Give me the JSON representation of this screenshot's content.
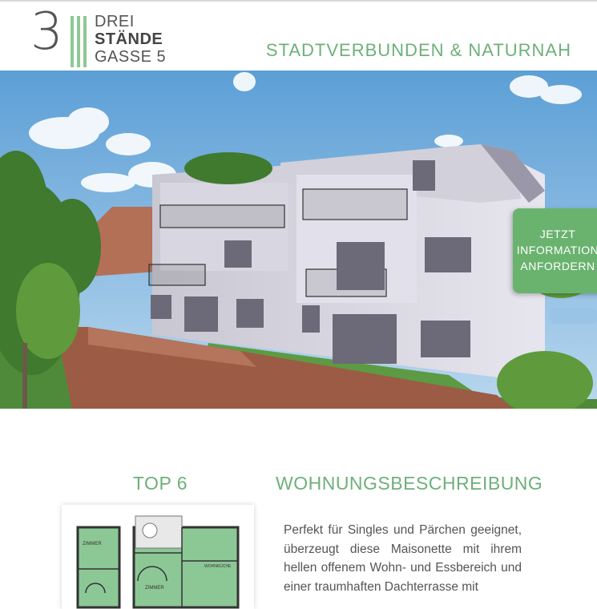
{
  "header": {
    "logo": {
      "number": "3",
      "line1": "DREI",
      "line2": "STÄNDE",
      "line3": "GASSE 5"
    },
    "tagline": "STADTVERBUNDEN & NATURNAH"
  },
  "hero": {
    "cta": {
      "line1": "JETZT",
      "line2": "INFORMATION",
      "line3": "ANFORDERN"
    }
  },
  "content": {
    "unit_label": "TOP 6",
    "section_title": "WOHNUNGSBESCHREIBUNG",
    "floorplan": {
      "room1": "ZIMMER",
      "room2": "ZIMMER",
      "room3": "WOHNKÜCHE"
    },
    "description": "Perfekt für Singles und Pärchen geeignet, überzeugt diese Maisonette mit ihrem hellen offenem Wohn- und Essbereich und einer traumhaften Dachterrasse mit"
  },
  "colors": {
    "accent_green": "#6eb07a",
    "logo_bars": "#8dc896",
    "cta_green": "#6ab36f",
    "text_gray": "#555555"
  }
}
